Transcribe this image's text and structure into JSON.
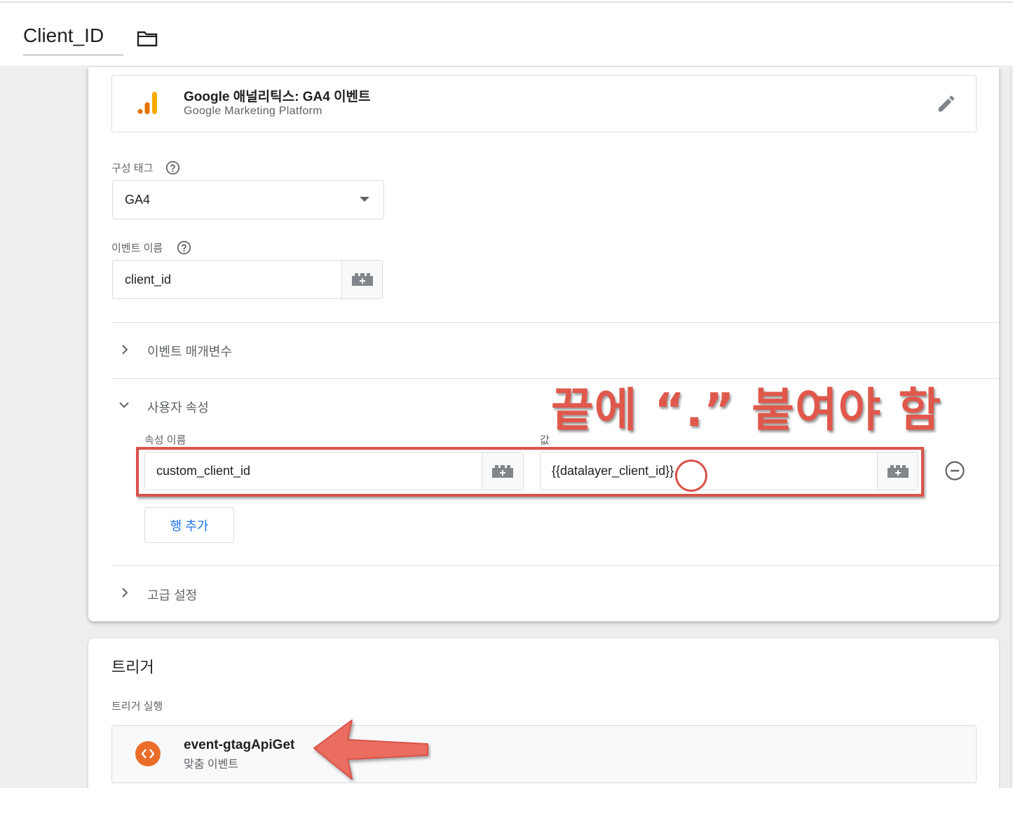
{
  "header": {
    "tag_name": "Client_ID",
    "folder_icon": "folder-icon"
  },
  "tag_type": {
    "title": "Google 애널리틱스: GA4 이벤트",
    "subtitle": "Google Marketing Platform",
    "logo_icon": "google-analytics-icon",
    "edit_icon": "pencil-icon"
  },
  "config_tag": {
    "label": "구성 태그",
    "value": "GA4"
  },
  "event_name": {
    "label": "이벤트 이름",
    "value": "client_id"
  },
  "sections": {
    "event_params": "이벤트 매개변수",
    "user_props": "사용자 속성",
    "advanced": "고급 설정"
  },
  "user_properties": {
    "name_header": "속성 이름",
    "value_header": "값",
    "rows": [
      {
        "name": "custom_client_id",
        "value": "{{datalayer_client_id}}."
      }
    ],
    "add_row_label": "행 추가"
  },
  "annotation": {
    "text": "끝에 “.” 붙여야 함",
    "color": "#e0584c"
  },
  "trigger": {
    "heading": "트리거",
    "firing_label": "트리거 실행",
    "item_name": "event-gtagApiGet",
    "item_type": "맞춤 이벤트",
    "icon": "custom-event-icon",
    "icon_color": "#ea6d2a"
  },
  "colors": {
    "accent": "#1a73e8",
    "annotation_red": "#d9544a"
  }
}
